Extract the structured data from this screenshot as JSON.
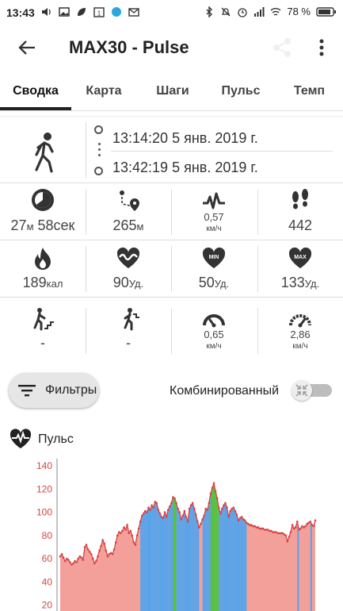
{
  "status_bar": {
    "time": "13:43",
    "battery": "78 %",
    "left_icons": [
      "volume-icon",
      "image-icon",
      "leaf-icon",
      "calendar-icon",
      "app-icon",
      "mail-icon"
    ],
    "right_icons": [
      "bluetooth-icon",
      "bell-off-icon",
      "alarm-icon",
      "signal-icon",
      "wifi-icon",
      "battery-icon"
    ]
  },
  "app_bar": {
    "title": "MAX30 - Pulse"
  },
  "tabs": [
    {
      "label": "Сводка",
      "active": true
    },
    {
      "label": "Карта",
      "active": false
    },
    {
      "label": "Шаги",
      "active": false
    },
    {
      "label": "Пульс",
      "active": false
    },
    {
      "label": "Темп",
      "active": false
    }
  ],
  "session": {
    "start": "13:14:20 5 янв. 2019 г.",
    "end": "13:42:19 5 янв. 2019 г."
  },
  "stats": {
    "row1": [
      {
        "icon": "timer-icon",
        "value": "27",
        "unit_small": "м",
        "value2": " 58сек",
        "sub": ""
      },
      {
        "icon": "route-icon",
        "value": "265",
        "unit_small": "м",
        "value2": "",
        "sub": ""
      },
      {
        "icon": "speed-wave-icon",
        "value": "0,57",
        "unit_small": "",
        "value2": "",
        "sub": "км/ч"
      },
      {
        "icon": "footprints-icon",
        "value": "442",
        "unit_small": "",
        "value2": "",
        "sub": ""
      }
    ],
    "row2": [
      {
        "icon": "flame-icon",
        "value": "189",
        "unit_small": "кал"
      },
      {
        "icon": "heart-wave-icon",
        "value": "90",
        "unit_small": "Уд."
      },
      {
        "icon": "heart-min-icon",
        "value": "50",
        "unit_small": "Уд."
      },
      {
        "icon": "heart-max-icon",
        "value": "133",
        "unit_small": "Уд."
      }
    ],
    "row3": [
      {
        "icon": "climb-up-icon",
        "value": "-",
        "sub": ""
      },
      {
        "icon": "climb-down-icon",
        "value": "-",
        "sub": ""
      },
      {
        "icon": "gauge-icon",
        "value": "0,65",
        "sub": "км/ч"
      },
      {
        "icon": "gauge-max-icon",
        "value": "2,86",
        "sub": "км/ч"
      }
    ],
    "heart_min_text": "MIN",
    "heart_max_text": "MAX"
  },
  "filters": {
    "button_label": "Фильтры",
    "combined_label": "Комбинированный",
    "combined_on": false
  },
  "pulse_section": {
    "label": "Пульс"
  },
  "chart_data": {
    "type": "area",
    "title": "",
    "xlabel": "",
    "ylabel": "",
    "ylim": [
      0,
      140
    ],
    "yticks": [
      20,
      40,
      60,
      80,
      100,
      120,
      140
    ],
    "colors": {
      "line": "#d84343",
      "fill": "#f4a09a",
      "blue": "#5aa4ea",
      "green": "#59c142",
      "tick": "#d84343"
    },
    "series": [
      {
        "values": [
          62,
          64,
          61,
          58,
          60,
          59,
          57,
          55,
          56,
          58,
          57,
          60,
          62,
          61,
          59,
          70,
          72,
          68,
          66,
          64,
          60,
          56,
          58,
          62,
          67,
          71,
          76,
          73,
          67,
          62,
          64,
          65,
          64,
          68,
          74,
          80,
          83,
          82,
          84,
          87,
          85,
          89,
          82,
          84,
          80,
          74,
          72,
          80,
          86,
          92,
          97,
          99,
          101,
          100,
          104,
          102,
          106,
          104,
          109,
          108,
          102,
          99,
          96,
          95,
          100,
          96,
          102,
          105,
          108,
          113,
          112,
          108,
          103,
          100,
          94,
          97,
          101,
          96,
          92,
          103,
          106,
          108,
          103,
          98,
          92,
          87,
          90,
          94,
          97,
          103,
          102,
          108,
          116,
          121,
          125,
          118,
          112,
          104,
          99,
          103,
          106,
          108,
          104,
          96,
          101,
          103,
          104,
          101,
          98,
          93,
          95,
          96,
          94,
          93,
          91,
          90,
          89,
          89,
          88,
          88,
          87,
          87,
          86,
          86,
          86,
          85,
          85,
          85,
          84,
          84,
          83,
          83,
          83,
          82,
          82,
          82,
          82,
          81,
          80,
          75,
          79,
          83,
          89,
          86,
          87,
          92,
          85,
          86,
          88,
          87,
          88,
          90,
          91,
          92,
          89,
          88,
          93
        ]
      }
    ]
  }
}
